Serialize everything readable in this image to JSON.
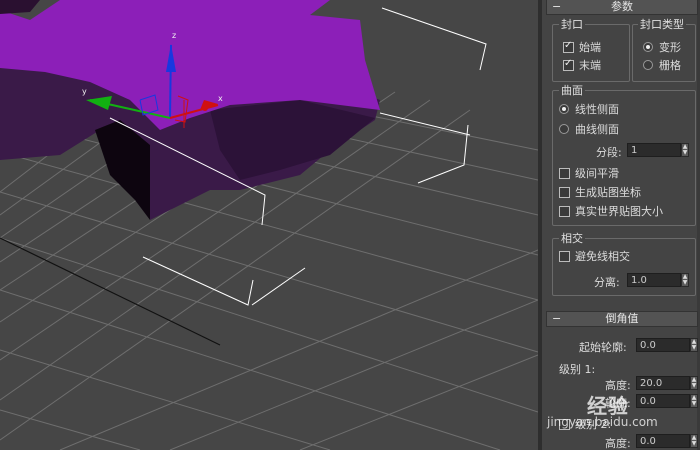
{
  "viewport": {
    "axis_labels": {
      "x": "x",
      "y": "y",
      "z": "z"
    },
    "colors": {
      "background": "#464646",
      "grid": "#6e6e6e",
      "object": "#8c1fb8",
      "object_dark": "#3a1a48",
      "selection": "#ffffff",
      "axis_x": "#d01010",
      "axis_y": "#12b012",
      "axis_z": "#1838e0"
    }
  },
  "params_rollout": {
    "title": "参数",
    "cap_group": {
      "label": "封口",
      "start": "始端",
      "end": "末端"
    },
    "cap_type_group": {
      "label": "封口类型",
      "morph": "变形",
      "grid": "栅格"
    },
    "surface_group": {
      "label": "曲面",
      "linear_sides": "线性侧面",
      "curved_sides": "曲线侧面",
      "segments_label": "分段:",
      "segments_value": "1",
      "smooth_across_levels": "级间平滑",
      "gen_mapping_coords": "生成贴图坐标",
      "real_world_map_size": "真实世界贴图大小"
    },
    "intersections_group": {
      "label": "相交",
      "keep_lines_from_crossing": "避免线相交",
      "separation_label": "分离:",
      "separation_value": "1.0"
    }
  },
  "bevel_rollout": {
    "title": "倒角值",
    "start_outline_label": "起始轮廓:",
    "start_outline_value": "0.0",
    "level1_label": "级别 1:",
    "level1_height_label": "高度:",
    "level1_height_value": "20.0",
    "level1_outline_label": "轮廓:",
    "level1_outline_value": "0.0",
    "level2_label": "级别 2:",
    "level2_height_label": "高度:",
    "level2_height_value": "0.0"
  },
  "watermark": {
    "main": "经验",
    "sub": "jingyan.baidu.com"
  }
}
